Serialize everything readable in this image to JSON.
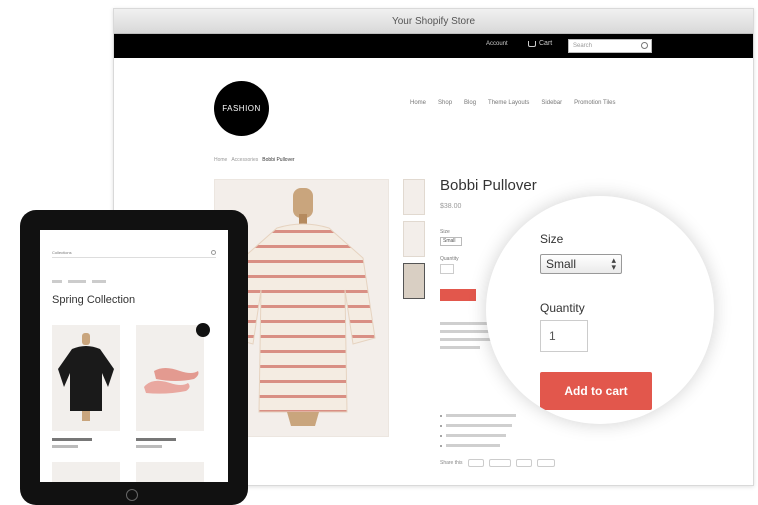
{
  "browser": {
    "title": "Your Shopify Store",
    "topbar": {
      "account": "Account",
      "cart": "Cart",
      "search_placeholder": "Search"
    }
  },
  "store": {
    "logo_text": "FASHION",
    "nav": [
      "Home",
      "Shop",
      "Blog",
      "Theme Layouts",
      "Sidebar",
      "Promotion Tiles"
    ],
    "breadcrumb": [
      "Home",
      "Accessories",
      "Bobbi Pullover"
    ]
  },
  "product": {
    "title": "Bobbi Pullover",
    "price": "$38.00",
    "size_label": "Size",
    "size_value": "Small",
    "quantity_label": "Quantity",
    "quantity_value": "1",
    "add_to_cart": "Add to cart",
    "share_label": "Share this"
  },
  "tablet": {
    "header": "Collections",
    "collection_title": "Spring Collection"
  },
  "colors": {
    "accent": "#e2574c",
    "topbar": "#000000",
    "logo_bg": "#000000"
  }
}
